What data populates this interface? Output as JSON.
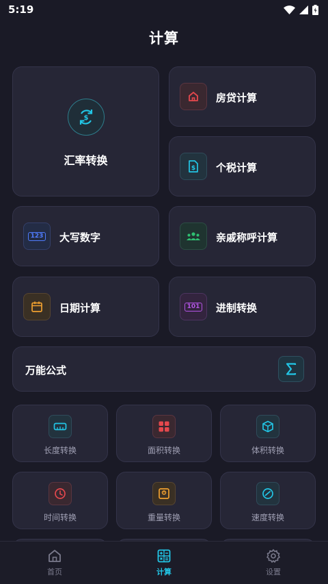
{
  "status_bar": {
    "time": "5:19"
  },
  "title": "计算",
  "cards": {
    "exchange": "汇率转换",
    "mortgage": "房贷计算",
    "income_tax": "个税计算",
    "uppercase_number": "大写数字",
    "uppercase_number_icon_text": "123",
    "relatives": "亲戚称呼计算",
    "date": "日期计算",
    "base_convert": "进制转换",
    "base_convert_icon_text": "101",
    "formula": "万能公式"
  },
  "small_cards": [
    {
      "label": "长度转换",
      "icon": "ruler-icon"
    },
    {
      "label": "面积转换",
      "icon": "grid-icon"
    },
    {
      "label": "体积转换",
      "icon": "cube-icon"
    },
    {
      "label": "时间转换",
      "icon": "clock-icon"
    },
    {
      "label": "重量转换",
      "icon": "weight-icon"
    },
    {
      "label": "速度转换",
      "icon": "speedometer-icon"
    }
  ],
  "bottom_nav": [
    {
      "label": "首页",
      "icon": "home-icon",
      "active": false
    },
    {
      "label": "计算",
      "icon": "calculator-icon",
      "active": true
    },
    {
      "label": "设置",
      "icon": "gear-icon",
      "active": false
    }
  ],
  "colors": {
    "background": "#1a1a26",
    "card": "#262636",
    "accent": "#22c6e6",
    "red": "#e5484d",
    "blue": "#4f7cff",
    "green": "#2fbf71",
    "orange": "#f0a030",
    "purple": "#b455e6"
  }
}
